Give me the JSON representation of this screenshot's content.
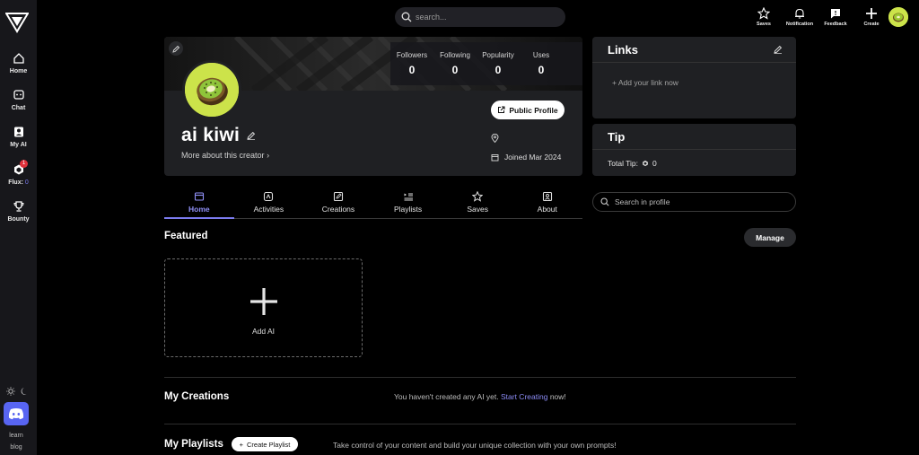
{
  "sidebar": {
    "items": [
      {
        "label": "Home"
      },
      {
        "label": "Chat"
      },
      {
        "label": "My AI"
      },
      {
        "label": "Flux:",
        "count": "0",
        "badge": "1"
      },
      {
        "label": "Bounty"
      }
    ],
    "footer": {
      "learn": "learn",
      "blog": "blog"
    }
  },
  "topbar": {
    "search_placeholder": "search...",
    "items": [
      {
        "label": "Saves"
      },
      {
        "label": "Notification"
      },
      {
        "label": "Feedback"
      },
      {
        "label": "Create"
      }
    ]
  },
  "profile": {
    "username": "ai kiwi",
    "more_creator": "More about this creator",
    "public_profile": "Public Profile",
    "joined": "Joined Mar 2024",
    "stats": [
      {
        "label": "Followers",
        "value": "0"
      },
      {
        "label": "Following",
        "value": "0"
      },
      {
        "label": "Popularity",
        "value": "0"
      },
      {
        "label": "Uses",
        "value": "0"
      }
    ]
  },
  "links": {
    "title": "Links",
    "add": "+ Add your link now"
  },
  "tip": {
    "title": "Tip",
    "total_label": "Total Tip:",
    "total_value": "0"
  },
  "tabs": [
    {
      "label": "Home",
      "active": true
    },
    {
      "label": "Activities"
    },
    {
      "label": "Creations"
    },
    {
      "label": "Playlists"
    },
    {
      "label": "Saves"
    },
    {
      "label": "About"
    }
  ],
  "profile_search_placeholder": "Search in profile",
  "featured": {
    "title": "Featured",
    "manage": "Manage",
    "add_ai": "Add AI"
  },
  "creations": {
    "title": "My Creations",
    "empty_prefix": "You haven't created any AI yet.",
    "empty_link": "Start Creating",
    "empty_suffix": "now!"
  },
  "playlists": {
    "title": "My Playlists",
    "create_button": "Create Playlist",
    "message": "Take control of your content and build your unique collection with your own prompts!"
  },
  "colors": {
    "accent": "#7c7cf0",
    "avatar": "#cce34a",
    "discord": "#5865f2",
    "badge": "#e0313b"
  }
}
